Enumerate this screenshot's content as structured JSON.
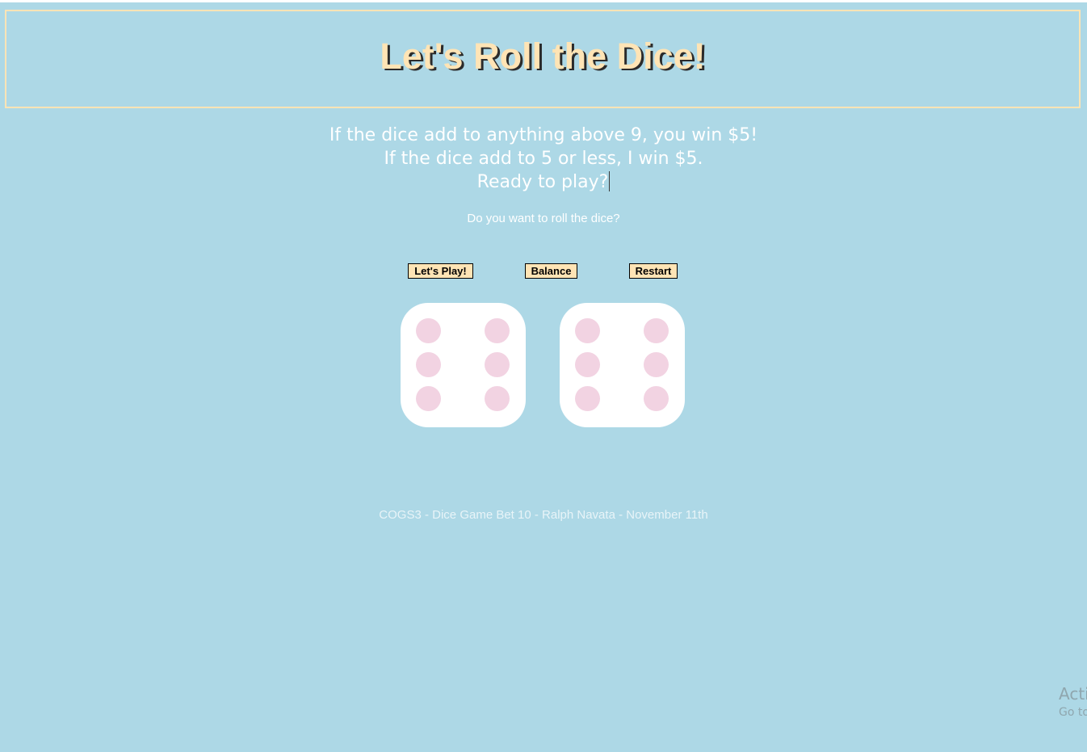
{
  "header": {
    "title": "Let's Roll the Dice!"
  },
  "intro": {
    "line1": "If the dice add to anything above 9, you win $5!",
    "line2": "If the dice add to 5 or less, I win $5.",
    "line3": "Ready to play?"
  },
  "prompt": {
    "question": "Do you want to roll the dice?"
  },
  "buttons": {
    "play_label": "Let's Play!",
    "balance_label": "Balance",
    "restart_label": "Restart"
  },
  "dice": [
    {
      "value": 6
    },
    {
      "value": 6
    }
  ],
  "colors": {
    "background": "#add8e6",
    "accent": "#ffe4b5",
    "pip": "#f2d3e2",
    "die": "#ffffff"
  },
  "footer": {
    "text": "COGS3 - Dice Game Bet 10 - Ralph Navata - November 11th"
  },
  "watermark": {
    "title": "Acti",
    "subtitle": "Go to"
  }
}
